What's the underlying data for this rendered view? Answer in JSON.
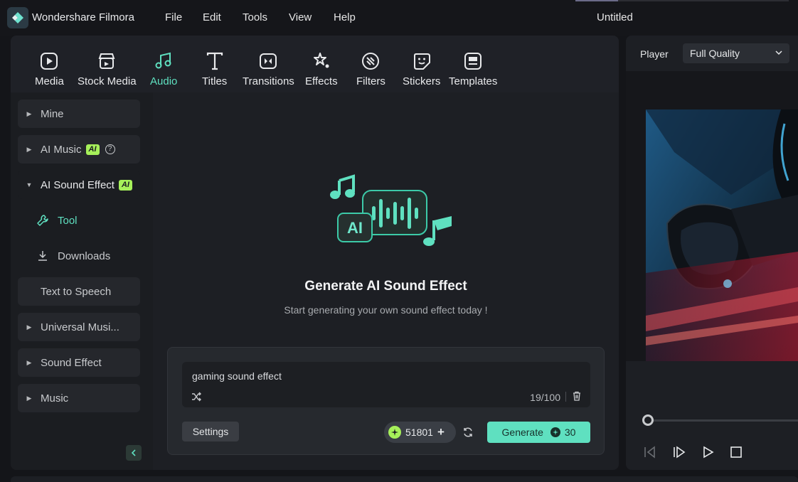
{
  "titlebar": {
    "app_name": "Wondershare Filmora",
    "menu": [
      "File",
      "Edit",
      "Tools",
      "View",
      "Help"
    ],
    "doc_title": "Untitled"
  },
  "toolbar": {
    "tabs": [
      {
        "label": "Media",
        "icon": "media-icon"
      },
      {
        "label": "Stock Media",
        "icon": "stock-media-icon"
      },
      {
        "label": "Audio",
        "icon": "audio-icon",
        "active": true
      },
      {
        "label": "Titles",
        "icon": "titles-icon"
      },
      {
        "label": "Transitions",
        "icon": "transitions-icon"
      },
      {
        "label": "Effects",
        "icon": "effects-icon"
      },
      {
        "label": "Filters",
        "icon": "filters-icon"
      },
      {
        "label": "Stickers",
        "icon": "stickers-icon"
      },
      {
        "label": "Templates",
        "icon": "templates-icon"
      }
    ]
  },
  "sidebar": {
    "items": [
      {
        "label": "Mine"
      },
      {
        "label": "AI Music",
        "badge": "AI"
      },
      {
        "label": "AI Sound Effect",
        "badge": "AI",
        "expanded": true
      },
      {
        "label": "Text to Speech"
      },
      {
        "label": "Universal Musi..."
      },
      {
        "label": "Sound Effect"
      },
      {
        "label": "Music"
      }
    ],
    "sub_items": [
      {
        "label": "Tool",
        "active": true
      },
      {
        "label": "Downloads"
      }
    ]
  },
  "content": {
    "title": "Generate AI Sound Effect",
    "subtitle": "Start generating your own sound effect today !",
    "art_badge": "AI",
    "prompt": {
      "value": "gaming sound effect",
      "char_count": "19/100"
    },
    "settings_label": "Settings",
    "credits": "51801",
    "generate_label": "Generate",
    "generate_cost": "30"
  },
  "player": {
    "label": "Player",
    "quality": "Full Quality"
  },
  "colors": {
    "accent": "#5fe0c0",
    "ai_badge": "#a6f05a",
    "panel": "#1d1f24",
    "background": "#141519"
  }
}
